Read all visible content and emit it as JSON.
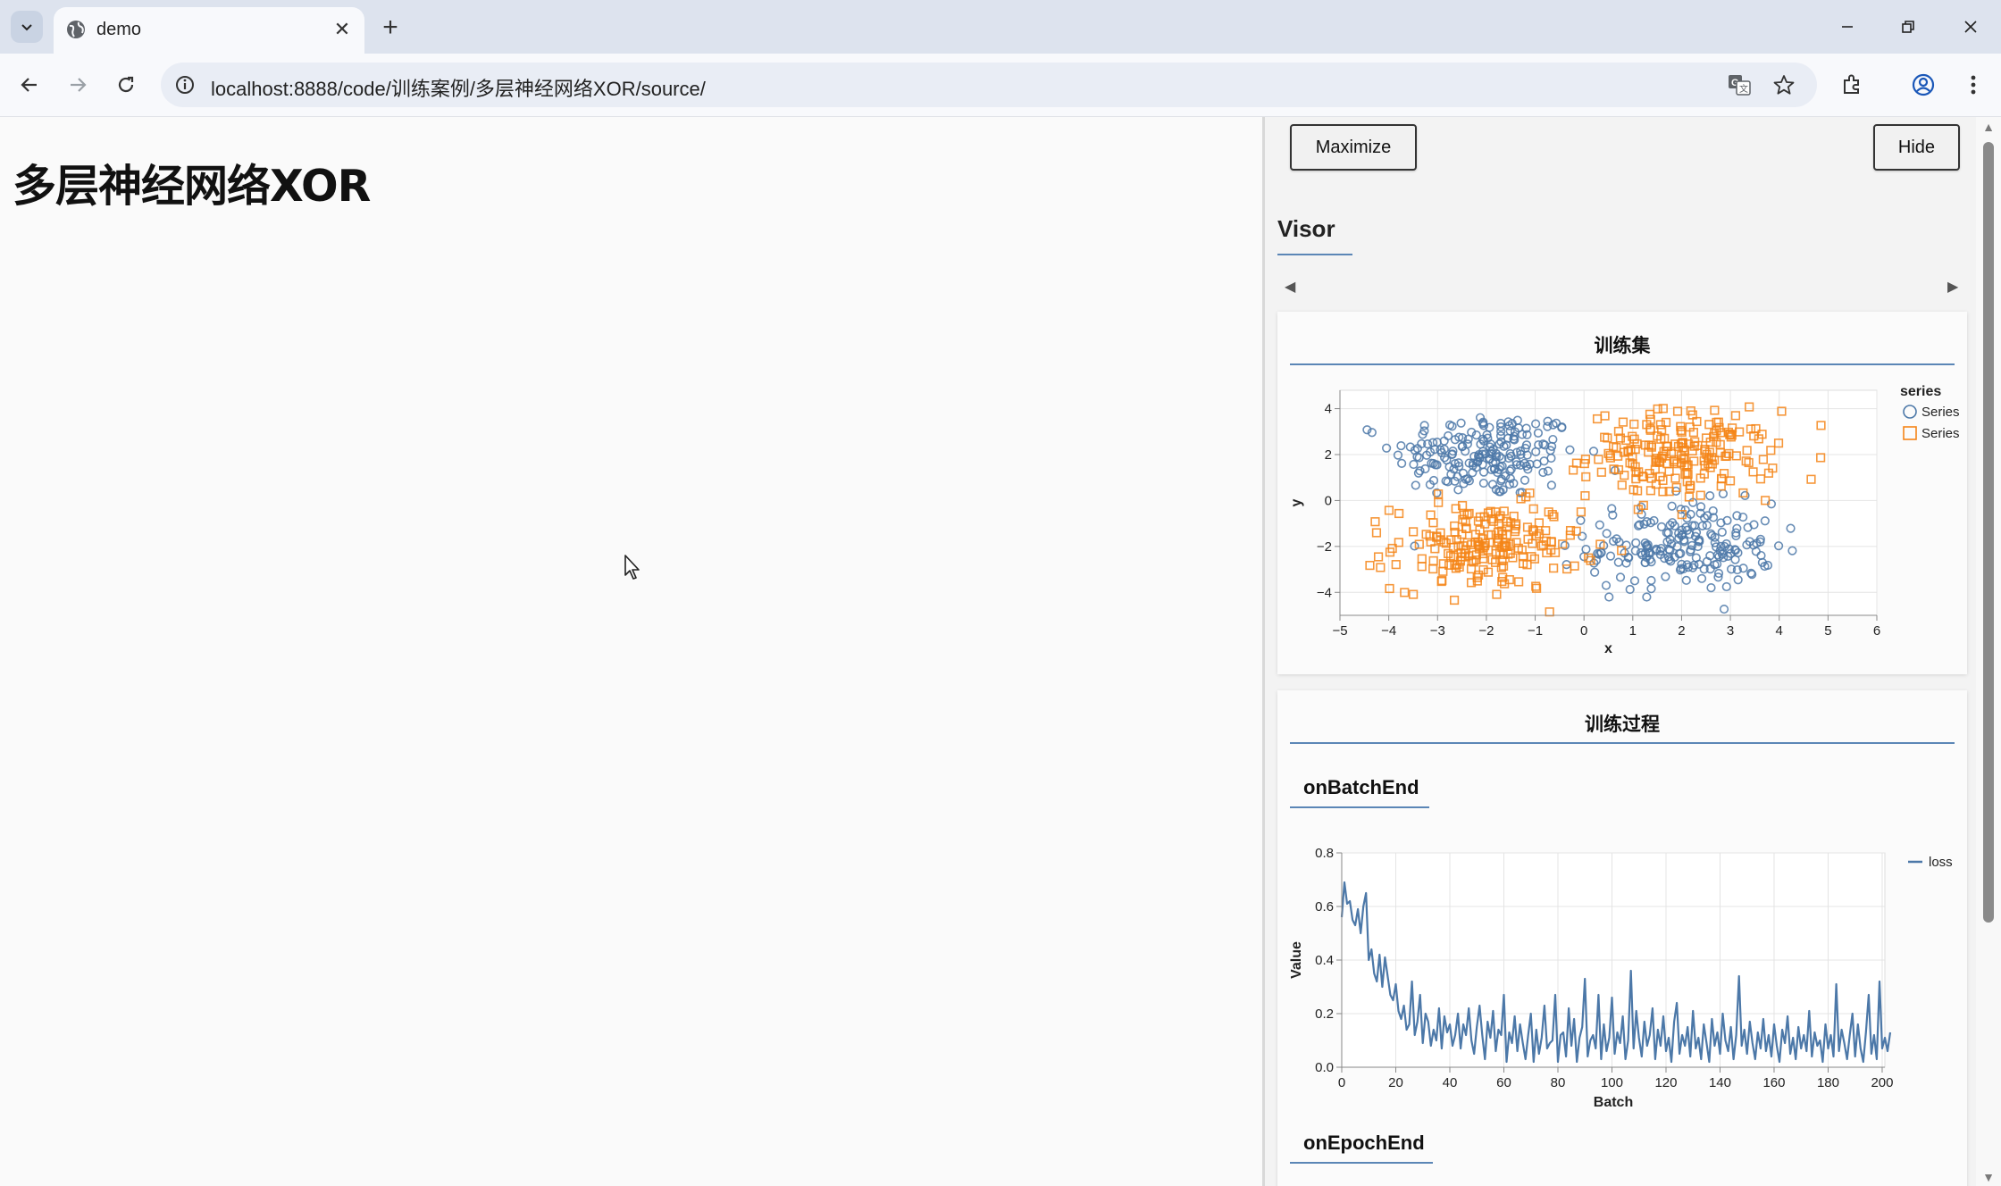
{
  "browser": {
    "tab_title": "demo",
    "url": "localhost:8888/code/训练案例/多层神经网络XOR/source/"
  },
  "page": {
    "title": "多层神经网络XOR"
  },
  "visor": {
    "maximize_label": "Maximize",
    "hide_label": "Hide",
    "name": "Visor",
    "surfaces": [
      {
        "title": "训练集"
      },
      {
        "title": "训练过程",
        "sub_tabs": [
          "onBatchEnd",
          "onEpochEnd"
        ]
      }
    ]
  },
  "chart_data": [
    {
      "type": "scatter",
      "title": "训练集",
      "xlabel": "x",
      "ylabel": "y",
      "xlim": [
        -5,
        6
      ],
      "ylim": [
        -5,
        4.8
      ],
      "xticks": [
        -5,
        -4,
        -3,
        -2,
        -1,
        0,
        1,
        2,
        3,
        4,
        5,
        6
      ],
      "yticks": [
        -4,
        -2,
        0,
        2,
        4
      ],
      "legend_title": "series",
      "legend_position": "right",
      "grid": true,
      "series": [
        {
          "name": "Series",
          "marker": "circle",
          "color": "#4c78a8",
          "clusters": [
            {
              "center": [
                -2,
                2
              ],
              "std": 0.95,
              "count": 200
            },
            {
              "center": [
                2,
                -2
              ],
              "std": 0.95,
              "count": 200
            }
          ]
        },
        {
          "name": "Series",
          "marker": "square",
          "color": "#f58518",
          "clusters": [
            {
              "center": [
                2,
                2
              ],
              "std": 0.95,
              "count": 200
            },
            {
              "center": [
                -2,
                -2
              ],
              "std": 0.95,
              "count": 200
            }
          ]
        }
      ]
    },
    {
      "type": "line",
      "xlabel": "Batch",
      "ylabel": "Value",
      "xlim": [
        0,
        201
      ],
      "ylim": [
        0,
        0.8
      ],
      "xticks": [
        0,
        20,
        40,
        60,
        80,
        100,
        120,
        140,
        160,
        180,
        200
      ],
      "yticks": [
        "0.0",
        "0.2",
        "0.4",
        "0.6",
        "0.8"
      ],
      "legend_position": "top-right",
      "grid": true,
      "series": [
        {
          "name": "loss",
          "color": "#4c78a8",
          "x_start": 0,
          "values": [
            0.56,
            0.69,
            0.61,
            0.62,
            0.55,
            0.53,
            0.59,
            0.5,
            0.6,
            0.65,
            0.4,
            0.44,
            0.35,
            0.32,
            0.42,
            0.3,
            0.41,
            0.34,
            0.27,
            0.25,
            0.31,
            0.21,
            0.18,
            0.23,
            0.14,
            0.16,
            0.32,
            0.12,
            0.17,
            0.27,
            0.09,
            0.2,
            0.17,
            0.08,
            0.14,
            0.1,
            0.22,
            0.07,
            0.19,
            0.13,
            0.16,
            0.08,
            0.12,
            0.2,
            0.07,
            0.16,
            0.12,
            0.22,
            0.1,
            0.05,
            0.15,
            0.23,
            0.12,
            0.03,
            0.17,
            0.11,
            0.21,
            0.06,
            0.14,
            0.12,
            0.27,
            0.02,
            0.13,
            0.09,
            0.19,
            0.06,
            0.16,
            0.09,
            0.03,
            0.12,
            0.2,
            0.02,
            0.14,
            0.05,
            0.11,
            0.23,
            0.07,
            0.09,
            0.1,
            0.27,
            0.02,
            0.12,
            0.13,
            0.04,
            0.22,
            0.08,
            0.18,
            0.02,
            0.11,
            0.15,
            0.33,
            0.04,
            0.1,
            0.12,
            0.07,
            0.27,
            0.03,
            0.16,
            0.06,
            0.11,
            0.26,
            0.05,
            0.13,
            0.09,
            0.19,
            0.03,
            0.1,
            0.36,
            0.07,
            0.21,
            0.11,
            0.04,
            0.17,
            0.08,
            0.12,
            0.22,
            0.03,
            0.14,
            0.08,
            0.19,
            0.06,
            0.11,
            0.02,
            0.17,
            0.24,
            0.05,
            0.12,
            0.08,
            0.15,
            0.04,
            0.21,
            0.07,
            0.11,
            0.03,
            0.16,
            0.09,
            0.02,
            0.18,
            0.08,
            0.13,
            0.05,
            0.2,
            0.1,
            0.06,
            0.15,
            0.03,
            0.12,
            0.34,
            0.08,
            0.14,
            0.05,
            0.17,
            0.09,
            0.03,
            0.13,
            0.07,
            0.18,
            0.06,
            0.12,
            0.04,
            0.16,
            0.08,
            0.02,
            0.14,
            0.09,
            0.19,
            0.05,
            0.11,
            0.03,
            0.15,
            0.07,
            0.12,
            0.06,
            0.21,
            0.04,
            0.13,
            0.08,
            0.1,
            0.02,
            0.16,
            0.07,
            0.12,
            0.04,
            0.31,
            0.06,
            0.14,
            0.09,
            0.03,
            0.12,
            0.2,
            0.04,
            0.16,
            0.07,
            0.02,
            0.13,
            0.27,
            0.05,
            0.12,
            0.03,
            0.32,
            0.07,
            0.11,
            0.06,
            0.13
          ]
        }
      ]
    }
  ]
}
